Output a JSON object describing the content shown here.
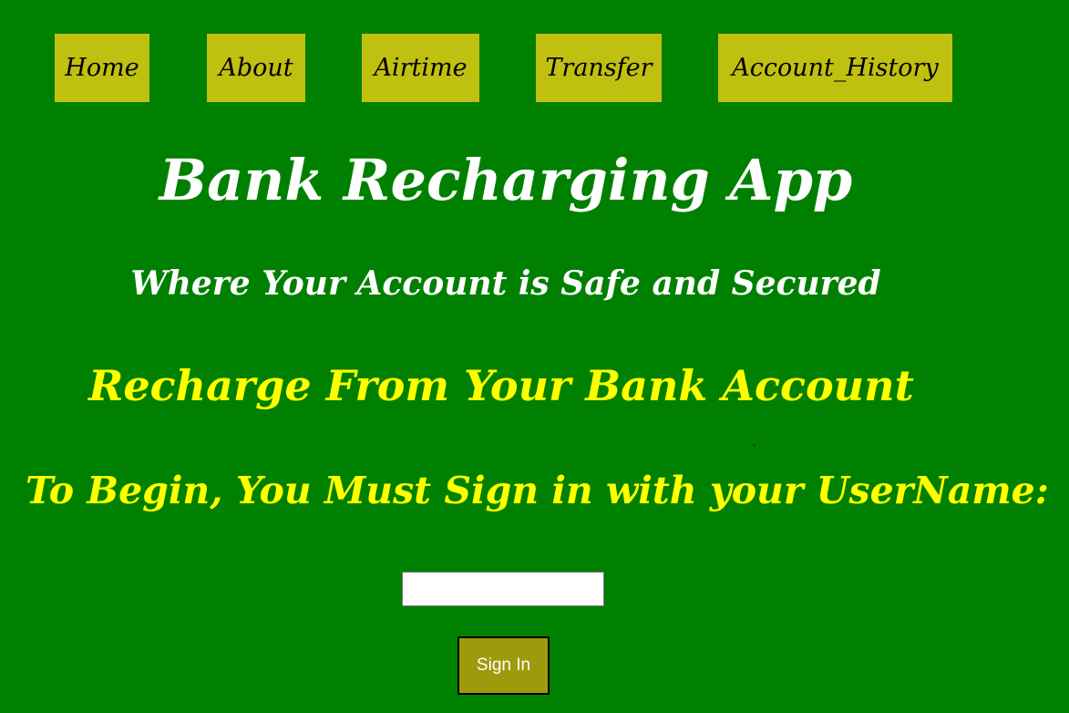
{
  "nav": {
    "items": [
      {
        "label": "Home"
      },
      {
        "label": "About"
      },
      {
        "label": "Airtime"
      },
      {
        "label": "Transfer"
      },
      {
        "label": "Account_History"
      }
    ]
  },
  "main": {
    "title": "Bank Recharging App",
    "tagline": "Where Your Account is Safe and Secured",
    "recharge_heading": "Recharge From Your Bank Account",
    "signin_prompt": "To Begin, You Must Sign in with your UserName:"
  },
  "form": {
    "username_value": "",
    "username_placeholder": "",
    "signin_label": "Sign In"
  },
  "colors": {
    "background": "#008000",
    "nav_item_bg": "#c0c011",
    "title_text": "#ffffff",
    "highlight_text": "#ffff00",
    "button_bg": "#9e9a0e"
  }
}
